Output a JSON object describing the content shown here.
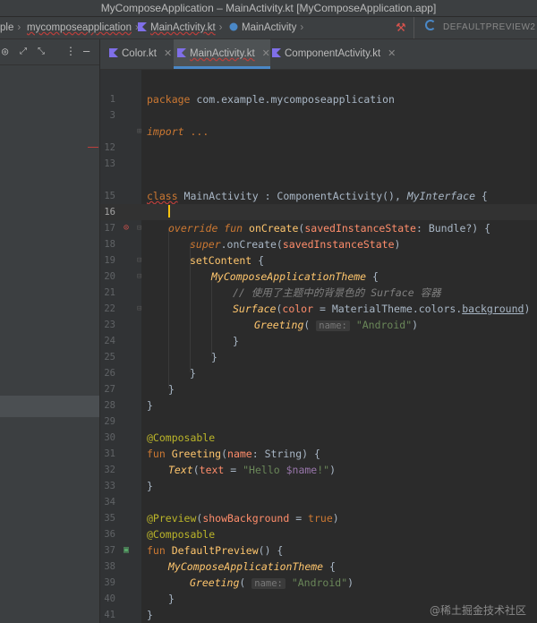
{
  "window": {
    "title": "MyComposeApplication – MainActivity.kt [MyComposeApplication.app]"
  },
  "breadcrumb": {
    "items": [
      "ple",
      "mycomposeapplication",
      "MainActivity.kt",
      "MainActivity"
    ]
  },
  "run_config": {
    "label": "DEFAULTPREVIEW2"
  },
  "tabs": [
    {
      "label": "Color.kt"
    },
    {
      "label": "MainActivity.kt"
    },
    {
      "label": "ComponentActivity.kt"
    }
  ],
  "editor": {
    "lines": [
      {
        "n": "1"
      },
      {
        "n": "3"
      },
      {
        "n": "12"
      },
      {
        "n": "13"
      },
      {
        "n": "15"
      },
      {
        "n": "16"
      },
      {
        "n": "17"
      },
      {
        "n": "18"
      },
      {
        "n": "19"
      },
      {
        "n": "20"
      },
      {
        "n": "21"
      },
      {
        "n": "22"
      },
      {
        "n": "23"
      },
      {
        "n": "24"
      },
      {
        "n": "25"
      },
      {
        "n": "26"
      },
      {
        "n": "27"
      },
      {
        "n": "28"
      },
      {
        "n": "29"
      },
      {
        "n": "30"
      },
      {
        "n": "31"
      },
      {
        "n": "32"
      },
      {
        "n": "33"
      },
      {
        "n": "34"
      },
      {
        "n": "35"
      },
      {
        "n": "36"
      },
      {
        "n": "37"
      },
      {
        "n": "38"
      },
      {
        "n": "39"
      },
      {
        "n": "40"
      },
      {
        "n": "41"
      }
    ],
    "t": {
      "package_kw": "package",
      "package_name": " com.example.mycomposeapplication",
      "import_kw": "import",
      "import_dots": " ...",
      "class_kw": "class",
      "class_name": " MainActivity",
      "colon": " : ",
      "super_class": "ComponentActivity",
      "parens_comma": "(), ",
      "interface": "MyInterface",
      "brace_open": " {",
      "override_kw": "override fun",
      "on_create": " onCreate",
      "p_open": "(",
      "param_sis": "savedInstanceState",
      "colon2": ": ",
      "bundle_type": "Bundle?",
      "p_close_brace": ") {",
      "super_kw": "super",
      "dot_on_create": ".onCreate(",
      "arg_sis": "savedInstanceState",
      "p_close": ")",
      "set_content": "setContent",
      "theme": "MyComposeApplicationTheme",
      "comment": "// 使用了主题中的背景色的 Surface 容器",
      "surface": "Surface",
      "color_param": "color",
      "eq": " = ",
      "material_theme": "MaterialTheme",
      "colors": ".colors.",
      "background": "background",
      "greeting": "Greeting",
      "hint_name": "name:",
      "android_str": "\"Android\"",
      "close_brace": "}",
      "composable_ann": "@Composable",
      "fun_kw": "fun",
      "greeting_fn": " Greeting",
      "name_param": "name",
      "string_type": "String",
      "text_fn": "Text",
      "text_param": "text",
      "hello_str_a": "\"Hello ",
      "hello_var": "$name",
      "hello_str_b": "!\"",
      "preview_ann": "@Preview",
      "show_bg": "showBackground",
      "true_kw": "true",
      "default_preview": " DefaultPreview",
      "empty_parens_brace": "() {"
    }
  },
  "watermark": "@稀土掘金技术社区"
}
